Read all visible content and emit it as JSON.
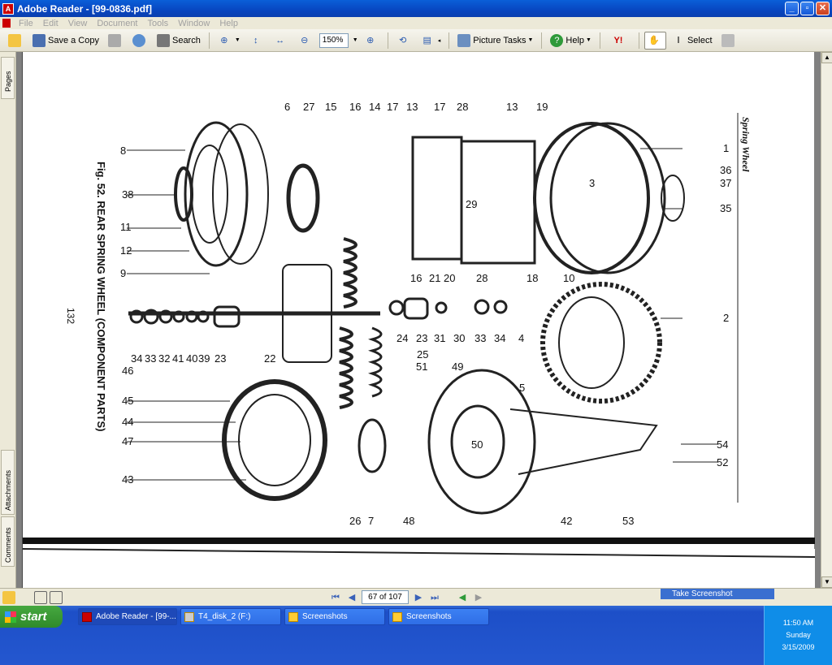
{
  "window": {
    "title": "Adobe Reader - [99-0836.pdf]"
  },
  "menu": [
    "File",
    "Edit",
    "View",
    "Document",
    "Tools",
    "Window",
    "Help"
  ],
  "toolbar": {
    "save_copy": "Save a Copy",
    "search": "Search",
    "zoom_value": "150%",
    "picture_tasks": "Picture Tasks",
    "help": "Help",
    "select": "Select"
  },
  "side_tabs": {
    "pages": "Pages",
    "attachments": "Attachments",
    "comments": "Comments"
  },
  "document": {
    "fig_caption": "Fig. 52.   REAR SPRING WHEEL (COMPONENT PARTS)",
    "page_number": "132",
    "header": "Spring Wheel",
    "callouts": [
      "6",
      "27",
      "15",
      "16",
      "14",
      "17",
      "13",
      "17",
      "28",
      "13",
      "19",
      "1",
      "36",
      "37",
      "35",
      "8",
      "38",
      "11",
      "12",
      "9",
      "3",
      "29",
      "16",
      "21",
      "20",
      "28",
      "18",
      "10",
      "2",
      "34",
      "33",
      "32",
      "41",
      "40",
      "39",
      "23",
      "22",
      "24",
      "23",
      "31",
      "30",
      "33",
      "34",
      "4",
      "5",
      "25",
      "46",
      "51",
      "49",
      "45",
      "44",
      "47",
      "43",
      "26",
      "7",
      "48",
      "50",
      "42",
      "53",
      "54",
      "52"
    ]
  },
  "statusbar": {
    "page_indicator": "67 of 107",
    "tooltip": "Take Screenshot"
  },
  "taskbar": {
    "start": "start",
    "tasks": [
      "Adobe Reader - [99-...",
      "T4_disk_2 (F:)",
      "Screenshots",
      "Screenshots"
    ],
    "clock": {
      "time": "11:50 AM",
      "day": "Sunday",
      "date": "3/15/2009"
    }
  }
}
